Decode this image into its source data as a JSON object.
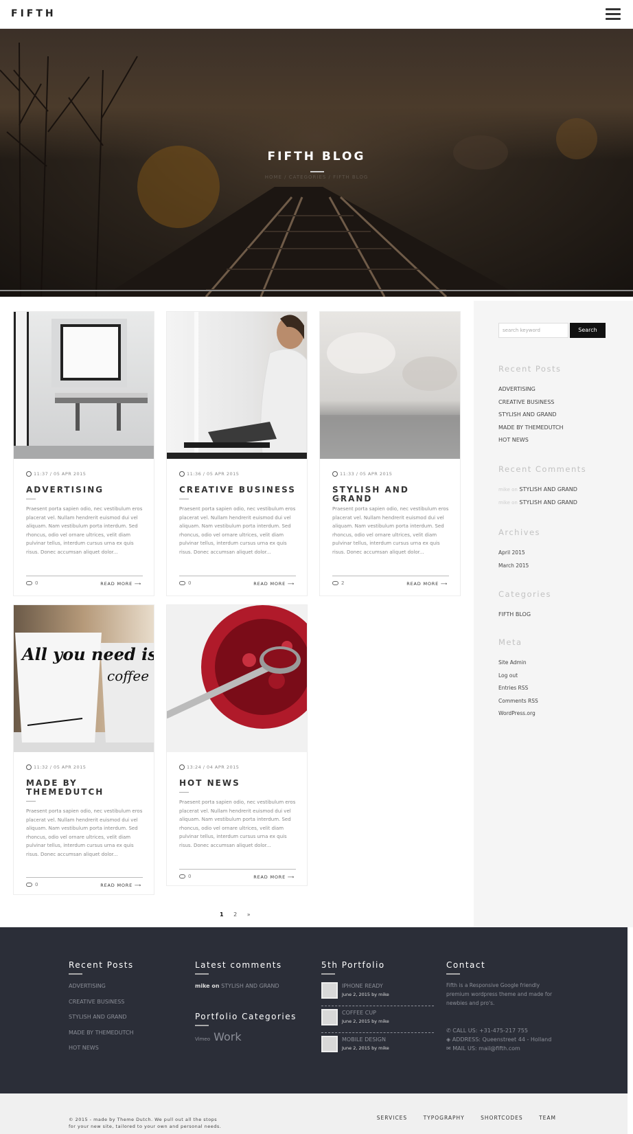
{
  "header": {
    "logo": "FIFTH"
  },
  "hero": {
    "title": "FIFTH BLOG",
    "breadcrumb": "HOME  /  CATEGORIES  /  FIFTH BLOG"
  },
  "sidebar": {
    "search_placeholder": "search keyword",
    "search_button": "Search",
    "recent_posts_title": "Recent Posts",
    "recent_posts": [
      "ADVERTISING",
      "CREATIVE BUSINESS",
      "STYLISH AND GRAND",
      "MADE BY THEMEDUTCH",
      "HOT NEWS"
    ],
    "recent_comments_title": "Recent Comments",
    "recent_comments": [
      {
        "author": "mike on",
        "post": "STYLISH AND GRAND"
      },
      {
        "author": "mike on",
        "post": "STYLISH AND GRAND"
      }
    ],
    "archives_title": "Archives",
    "archives": [
      "April 2015",
      "March 2015"
    ],
    "categories_title": "Categories",
    "categories": [
      "FIFTH BLOG"
    ],
    "meta_title": "Meta",
    "meta": [
      "Site Admin",
      "Log out",
      "Entries RSS",
      "Comments RSS",
      "WordPress.org"
    ]
  },
  "posts": [
    {
      "time": "11:37 / 05 APR 2015",
      "title": "ADVERTISING",
      "comments": "0",
      "read_more": "READ MORE"
    },
    {
      "time": "11:36 / 05 APR 2015",
      "title": "CREATIVE BUSINESS",
      "comments": "0",
      "read_more": "READ MORE"
    },
    {
      "time": "11:33 / 05 APR 2015",
      "title": "STYLISH AND GRAND",
      "comments": "2",
      "read_more": "READ MORE"
    },
    {
      "time": "11:32 / 05 APR 2015",
      "title": "MADE BY THEMEDUTCH",
      "comments": "0",
      "read_more": "READ MORE"
    },
    {
      "time": "13:24 / 04 APR 2015",
      "title": "HOT NEWS",
      "comments": "0",
      "read_more": "READ MORE"
    }
  ],
  "excerpt": "Praesent porta sapien odio, nec vestibulum eros placerat vel. Nullam hendrerit euismod dui vel aliquam. Nam vestibulum porta interdum. Sed rhoncus, odio vel ornare ultrices, velit diam pulvinar tellus, interdum cursus urna ex quis risus. Donec accumsan aliquet dolor...",
  "image_texts": {
    "mug_left": "All you need is...",
    "mug_right": "coffee"
  },
  "pagination": [
    "1",
    "2",
    "»"
  ],
  "footer": {
    "recent_posts_title": "Recent Posts",
    "recent_posts": [
      "ADVERTISING",
      "CREATIVE BUSINESS",
      "STYLISH AND GRAND",
      "MADE BY THEMEDUTCH",
      "HOT NEWS"
    ],
    "latest_comments_title": "Latest comments",
    "latest_comment_author": "mike on",
    "latest_comment_post": "STYLISH AND GRAND",
    "portfolio_categories_title": "Portfolio Categories",
    "portfolio_categories": [
      "Vimeo",
      "Work"
    ],
    "portfolio_title": "5th Portfolio",
    "portfolio_items": [
      {
        "title": "IPHONE READY",
        "date": "June 2, 2015 by mike"
      },
      {
        "title": "COFFEE CUP",
        "date": "June 2, 2015 by mike"
      },
      {
        "title": "MOBILE DESIGN",
        "date": "June 2, 2015 by mike"
      }
    ],
    "contact_title": "Contact",
    "contact_text": "Fifth is a Responsive Google friendly premium wordpress theme and made for newbies and pro's.",
    "contact_call": "CALL US: +31-475-217 755",
    "contact_address": "ADDRESS: Queenstreet 44 - Holland",
    "contact_mail": "MAIL US: mail@fifth.com"
  },
  "bottombar": {
    "copyright_line1": "© 2015 - made by Theme Dutch. We pull out all the stops",
    "copyright_line2": "for your new site, tailored to your own and personal needs.",
    "nav": [
      "SERVICES",
      "TYPOGRAPHY",
      "SHORTCODES",
      "TEAM"
    ]
  },
  "colors": {
    "footer_bg": "#2b2e38",
    "sidebar_bg": "#f5f5f5",
    "search_button_bg": "#111111"
  }
}
